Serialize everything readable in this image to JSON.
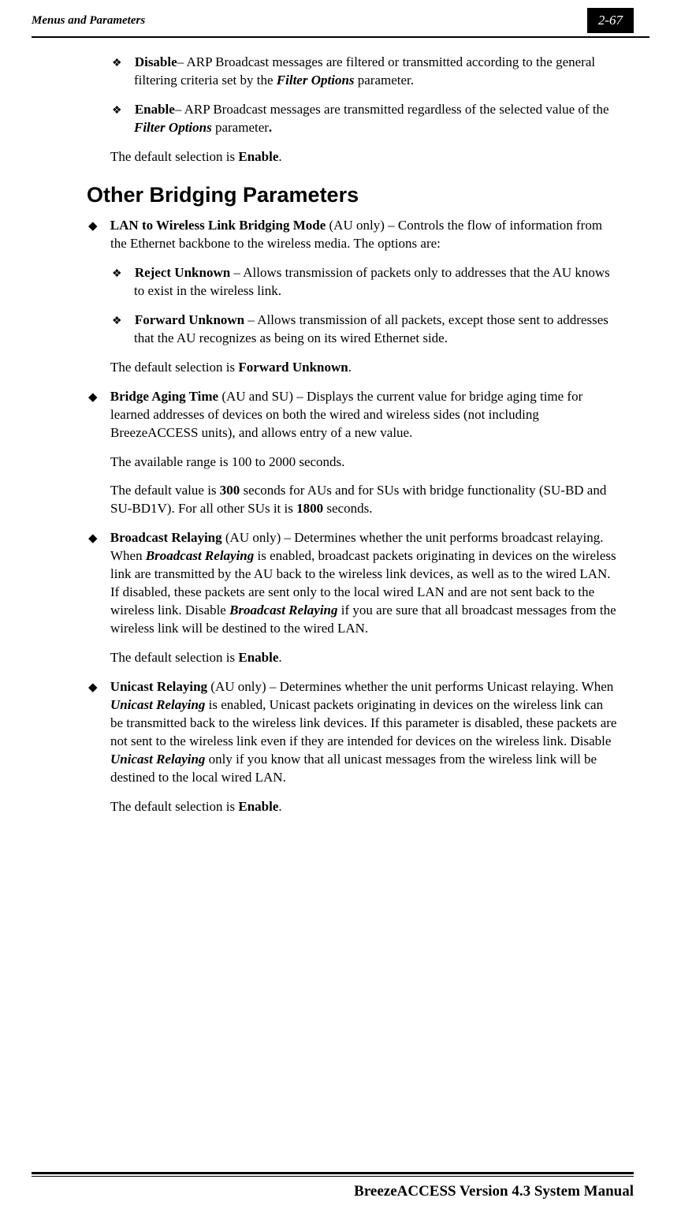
{
  "header": {
    "left": "Menus and Parameters",
    "right": "2-67"
  },
  "sub1": {
    "label": "Disable",
    "dash": "– ARP Broadcast messages are filtered or transmitted according to the general filtering criteria set by the ",
    "italic": "Filter Options",
    "after": " parameter."
  },
  "sub2": {
    "label": "Enable",
    "dash": "– ARP Broadcast messages are transmitted regardless of the selected value of the ",
    "italic": "Filter Options",
    "after": " parameter",
    "period": "."
  },
  "default1a": "The default selection is ",
  "default1b": "Enable",
  "default1c": ".",
  "heading": "Other Bridging Parameters",
  "m1": {
    "label": "LAN to Wireless Link Bridging Mode",
    "text": " (AU only) – Controls the flow of information from the Ethernet backbone to the wireless media. The options are:"
  },
  "m1s1": {
    "label": "Reject Unknown",
    "text": " – Allows transmission of packets only to addresses that the AU knows to exist in the wireless link."
  },
  "m1s2": {
    "label": "Forward Unknown",
    "text": " – Allows transmission of all packets, except those sent to addresses that the AU recognizes as being on its wired Ethernet side."
  },
  "m1defa": "The default selection is ",
  "m1defb": "Forward Unknown",
  "m1defc": ".",
  "m2": {
    "label": "Bridge Aging Time",
    "text": " (AU and SU) – Displays the current value for bridge aging time for learned addresses of devices on both the wired and wireless sides (not including BreezeACCESS units), and allows entry of a new value."
  },
  "m2line2": "The available range is 100 to 2000 seconds.",
  "m2line3a": "The default value is ",
  "m2line3b": "300",
  "m2line3c": " seconds for AUs and for SUs with bridge functionality (SU-BD and SU-BD1V). For all other SUs it is ",
  "m2line3d": "1800",
  "m2line3e": " seconds.",
  "m3": {
    "label": "Broadcast Relaying",
    "t1": " (AU only) – Determines whether the unit performs broadcast relaying. When ",
    "i1": "Broadcast Relaying",
    "t2": " is enabled, broadcast packets originating in devices on the wireless link are transmitted by the AU back to the wireless link devices, as well as to the wired LAN. If disabled, these packets are sent only to the local wired LAN and are not sent back to the wireless link. Disable ",
    "i2": "Broadcast Relaying",
    "t3": " if you are sure that all broadcast messages from the wireless link will be destined to the wired LAN."
  },
  "m3defa": "The default selection is ",
  "m3defb": "Enable",
  "m3defc": ".",
  "m4": {
    "label": "Unicast Relaying",
    "t1": " (AU only) – Determines whether the unit performs Unicast relaying. When ",
    "i1": "Unicast Relaying",
    "t2": " is enabled, Unicast packets originating in devices on the wireless link can be transmitted back to the wireless link devices. If this parameter is disabled, these packets are not sent to the wireless link even if they are intended for devices on the wireless link. Disable ",
    "i2": "Unicast Relaying",
    "t3": " only if you know that all unicast messages from the wireless link will be destined to the local wired LAN."
  },
  "m4defa": "The default selection is ",
  "m4defb": "Enable",
  "m4defc": ".",
  "footer": "BreezeACCESS Version 4.3 System Manual"
}
